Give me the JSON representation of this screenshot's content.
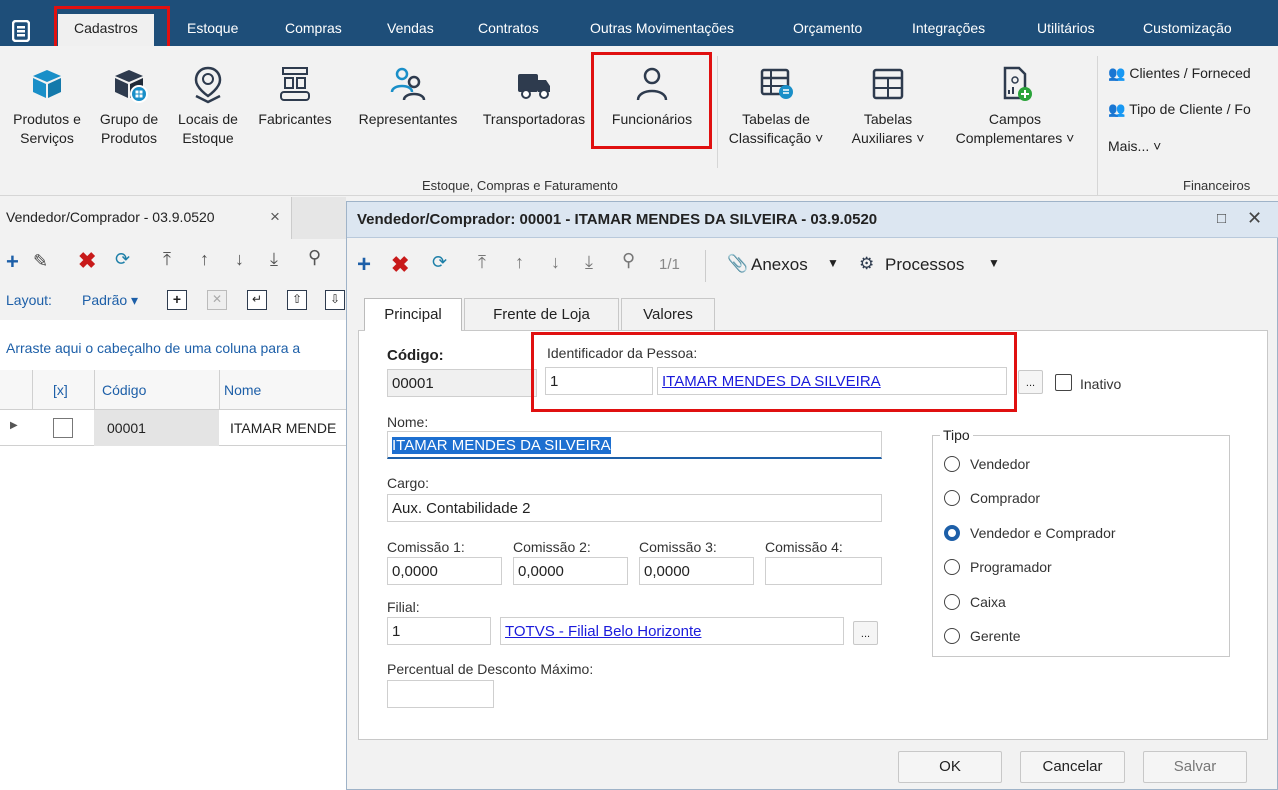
{
  "menu": {
    "items": [
      "Cadastros",
      "Estoque",
      "Compras",
      "Vendas",
      "Contratos",
      "Outras Movimentações",
      "Orçamento",
      "Integrações",
      "Utilitários",
      "Customização"
    ]
  },
  "ribbon": {
    "buttons": [
      {
        "line1": "Produtos e",
        "line2": "Serviços"
      },
      {
        "line1": "Grupo de",
        "line2": "Produtos"
      },
      {
        "line1": "Locais de",
        "line2": "Estoque"
      },
      {
        "line1": "Fabricantes",
        "line2": ""
      },
      {
        "line1": "Representantes",
        "line2": ""
      },
      {
        "line1": "Transportadoras",
        "line2": ""
      },
      {
        "line1": "Funcionários",
        "line2": ""
      },
      {
        "line1": "Tabelas de",
        "line2": "Classificação ˅"
      },
      {
        "line1": "Tabelas",
        "line2": "Auxiliares ˅"
      },
      {
        "line1": "Campos",
        "line2": "Complementares ˅"
      }
    ],
    "group_label": "Estoque, Compras e Faturamento",
    "right_items": [
      "Clientes / Forneced",
      "Tipo de Cliente / Fo",
      "Mais...  ˅"
    ],
    "right_group_label": "Financeiros"
  },
  "left": {
    "tab_title": "Vendedor/Comprador - 03.9.0520",
    "tab_close": "×",
    "layout_label": "Layout:",
    "layout_value": "Padrão ▾",
    "group_hint": "Arraste aqui o cabeçalho de uma coluna para a",
    "grid_headers": [
      "[x]",
      "Código",
      "Nome"
    ],
    "rows": [
      {
        "code": "00001",
        "name": "ITAMAR MENDE"
      }
    ]
  },
  "dialog": {
    "title": "Vendedor/Comprador: 00001 - ITAMAR MENDES DA SILVEIRA - 03.9.0520",
    "pager": "1/1",
    "anexos": "Anexos",
    "processos": "Processos",
    "tabs": [
      "Principal",
      "Frente de Loja",
      "Valores"
    ],
    "codigo_label": "Código:",
    "codigo_value": "00001",
    "ident_label": "Identificador da Pessoa:",
    "ident_value": "1",
    "ident_name": "ITAMAR MENDES DA SILVEIRA",
    "ellipsis": "...",
    "inativo_label": "Inativo",
    "nome_label": "Nome:",
    "nome_value": "ITAMAR MENDES DA SILVEIRA",
    "cargo_label": "Cargo:",
    "cargo_value": "Aux. Contabilidade 2",
    "comissoes": [
      {
        "label": "Comissão 1:",
        "value": "0,0000"
      },
      {
        "label": "Comissão 2:",
        "value": "0,0000"
      },
      {
        "label": "Comissão 3:",
        "value": "0,0000"
      },
      {
        "label": "Comissão 4:",
        "value": ""
      }
    ],
    "filial_label": "Filial:",
    "filial_value": "1",
    "filial_name": "TOTVS - Filial Belo Horizonte",
    "desconto_label": "Percentual de Desconto Máximo:",
    "desconto_value": "",
    "tipo_label": "Tipo",
    "tipos": [
      {
        "label": "Vendedor",
        "selected": false
      },
      {
        "label": "Comprador",
        "selected": false
      },
      {
        "label": "Vendedor e Comprador",
        "selected": true
      },
      {
        "label": "Programador",
        "selected": false
      },
      {
        "label": "Caixa",
        "selected": false
      },
      {
        "label": "Gerente",
        "selected": false
      }
    ],
    "ok": "OK",
    "cancelar": "Cancelar",
    "salvar": "Salvar"
  },
  "colors": {
    "menubar": "#1e4e79",
    "highlight": "#e01010",
    "icon_blue": "#1a8fc8",
    "icon_dark": "#2e3b4e",
    "link": "#1a1adb"
  }
}
